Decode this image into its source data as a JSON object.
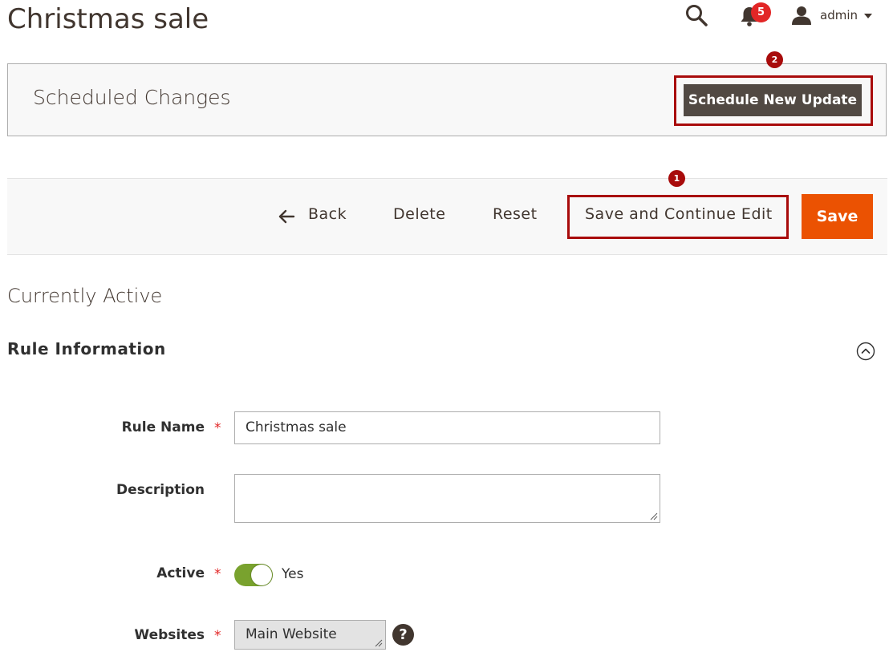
{
  "page": {
    "title": "Christmas sale"
  },
  "header": {
    "search_icon": "search-icon",
    "notifications_count": "5",
    "user_name": "admin"
  },
  "scheduled": {
    "title": "Scheduled Changes",
    "button_label": "Schedule New Update",
    "callout_number": "2"
  },
  "actions": {
    "back_label": "Back",
    "delete_label": "Delete",
    "reset_label": "Reset",
    "save_continue_label": "Save and Continue Edit",
    "save_label": "Save",
    "callout_number": "1"
  },
  "sections": {
    "currently_active": "Currently Active",
    "rule_information": "Rule Information"
  },
  "form": {
    "rule_name_label": "Rule Name",
    "rule_name_value": "Christmas sale",
    "description_label": "Description",
    "description_value": "",
    "active_label": "Active",
    "active_value": "Yes",
    "websites_label": "Websites",
    "websites_value": "Main Website",
    "required_marker": "*",
    "help_glyph": "?"
  },
  "colors": {
    "primary_button": "#eb5202",
    "dark_button": "#514943",
    "callout": "#a80b0b",
    "toggle_on": "#79a22e",
    "notification_badge": "#e22626"
  }
}
